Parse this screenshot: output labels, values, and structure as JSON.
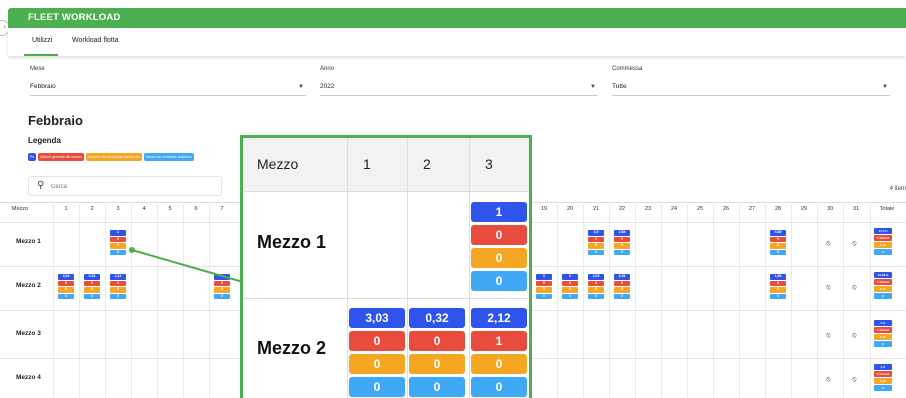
{
  "header": {
    "title": "FLEET WORKLOAD"
  },
  "tabs": [
    {
      "label": "Utilizzi"
    },
    {
      "label": "Workload flotta"
    }
  ],
  "filters": {
    "month": {
      "label": "Mese",
      "value": "Febbraio"
    },
    "year": {
      "label": "Anno",
      "value": "2022"
    },
    "order": {
      "label": "Commessa",
      "value": "Tutte"
    }
  },
  "month_title": "Febbraio",
  "legend": {
    "title": "Legenda",
    "items": [
      {
        "label": "Pri",
        "color": "#2f54eb"
      },
      {
        "label": "Allarmi generati dal mezzo",
        "color": "#e74c3c"
      },
      {
        "label": "Ampere ora consumati dal mezzo",
        "color": "#f5a623"
      },
      {
        "label": "Valore del contatore ausiliario",
        "color": "#3fa9f5"
      }
    ]
  },
  "search": {
    "placeholder": "Cerca"
  },
  "items_count": "4 item",
  "table": {
    "col_mezzo": "Mezzo",
    "days": [
      "1",
      "2",
      "3",
      "4",
      "5",
      "6",
      "7",
      "19",
      "20",
      "21",
      "22",
      "23",
      "24",
      "25",
      "26",
      "27",
      "28",
      "29",
      "30",
      "31"
    ],
    "col_total": "Totale",
    "rows": [
      {
        "name": "Mezzo 1",
        "cells": [
          {
            "day": "3",
            "values": [
              "1",
              "0",
              "0",
              "0"
            ]
          },
          {
            "day": "21",
            "values": [
              "3,9",
              "0",
              "0",
              "0"
            ]
          },
          {
            "day": "22",
            "values": [
              "2,88",
              "0",
              "0",
              "0"
            ]
          },
          {
            "day": "28",
            "values": [
              "5,55",
              "0",
              "0",
              "0"
            ]
          }
        ],
        "total": [
          "17,5 H",
          "0 Allarmi",
          "0 Ah",
          "0"
        ]
      },
      {
        "name": "Mezzo 2",
        "cells": [
          {
            "day": "1",
            "values": [
              "3,03",
              "0",
              "0",
              "0"
            ]
          },
          {
            "day": "2",
            "values": [
              "0,32",
              "0",
              "0",
              "0"
            ]
          },
          {
            "day": "3",
            "values": [
              "2,12",
              "1",
              "0",
              "0"
            ]
          },
          {
            "day": "7",
            "values": [
              "0",
              "0",
              "0",
              "0"
            ]
          },
          {
            "day": "19",
            "values": [
              "0",
              "0",
              "0",
              "0"
            ]
          },
          {
            "day": "20",
            "values": [
              "0",
              "0",
              "0",
              "0"
            ]
          },
          {
            "day": "21",
            "values": [
              "2,03",
              "4",
              "0",
              "0"
            ]
          },
          {
            "day": "22",
            "values": [
              "4,36",
              "2",
              "0",
              "0"
            ]
          },
          {
            "day": "28",
            "values": [
              "1,56",
              "0",
              "0",
              "0"
            ]
          }
        ],
        "total": [
          "24,68 H",
          "7 Allarmi",
          "0 Ah",
          "0"
        ]
      },
      {
        "name": "Mezzo 3",
        "cells": [],
        "total": [
          "0 H",
          "0 Allarmi",
          "0 Ah",
          "0"
        ]
      },
      {
        "name": "Mezzo 4",
        "cells": [],
        "total": [
          "0 H",
          "0 Allarmi",
          "0 Ah",
          "0"
        ]
      }
    ]
  },
  "zoom": {
    "head": [
      "Mezzo",
      "1",
      "2",
      "3"
    ],
    "rows": [
      {
        "name": "Mezzo 1",
        "cols": [
          null,
          null,
          [
            "1",
            "0",
            "0",
            "0"
          ]
        ]
      },
      {
        "name": "Mezzo 2",
        "cols": [
          [
            "3,03",
            "0",
            "0",
            "0"
          ],
          [
            "0,32",
            "0",
            "0",
            "0"
          ],
          [
            "2,12",
            "1",
            "0",
            "0"
          ]
        ]
      }
    ]
  },
  "icons": {
    "unavailable": "block-icon",
    "search": "search-icon",
    "dropdown": "caret-down-icon",
    "sidebar": "sidebar-toggle-icon"
  },
  "colors": {
    "brand": "#4caf50",
    "hours": "#2f54eb",
    "alarms": "#e74c3c",
    "ampere": "#f5a623",
    "counter": "#3fa9f5"
  }
}
